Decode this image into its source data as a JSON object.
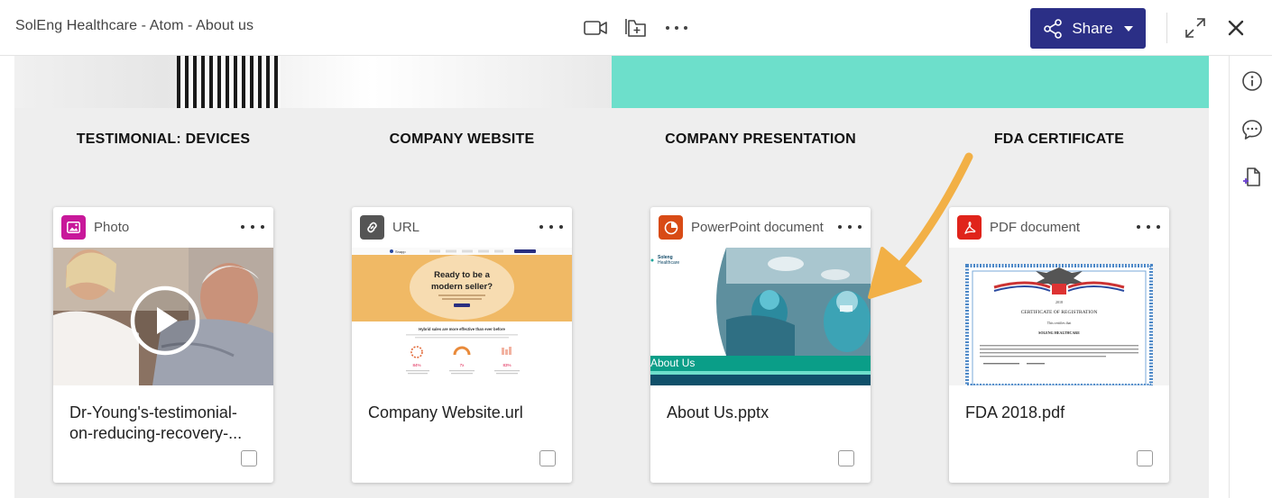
{
  "header": {
    "title": "SolEng Healthcare - Atom - About us",
    "share_label": "Share",
    "icons": [
      "video-icon",
      "add-to-folder-icon",
      "more-horizontal-icon",
      "expand-icon",
      "close-icon"
    ]
  },
  "rail": {
    "icons": [
      "info-icon",
      "comment-icon",
      "add-document-icon"
    ]
  },
  "columns": [
    {
      "heading": "TESTIMONIAL: DEVICES",
      "type_label": "Photo",
      "file_name": "Dr-Young's-testimonial-on-reducing-recovery-...",
      "accent": "#c8189a",
      "icon": "photo-icon"
    },
    {
      "heading": "COMPANY WEBSITE",
      "type_label": "URL",
      "file_name": "Company Website.url",
      "accent": "#555555",
      "icon": "link-icon"
    },
    {
      "heading": "COMPANY PRESENTATION",
      "type_label": "PowerPoint document",
      "file_name": "About Us.pptx",
      "accent": "#d84b16",
      "icon": "powerpoint-icon"
    },
    {
      "heading": "FDA CERTIFICATE",
      "type_label": "PDF document",
      "file_name": "FDA 2018.pdf",
      "accent": "#e0241b",
      "icon": "pdf-icon"
    }
  ],
  "thumbnails": {
    "website": {
      "logo": "Snapp",
      "nav_cta": "",
      "hero_text": "Ready to be a modern seller?",
      "section_title": "Hybrid sales are more effective than ever before",
      "stats": [
        "84%",
        "7x",
        "83%"
      ]
    },
    "presentation": {
      "brand": "Soleng Healthcare",
      "banner": "About Us"
    },
    "certificate": {
      "year": "2018",
      "title": "CERTIFICATE OF REGISTRATION",
      "line1": "This certifies that",
      "company": "SOLENG HEALTHCARE"
    }
  },
  "colors": {
    "share_button": "#2b2f86",
    "teal_banner": "#6ddfcb",
    "arrow": "#f2b046"
  }
}
